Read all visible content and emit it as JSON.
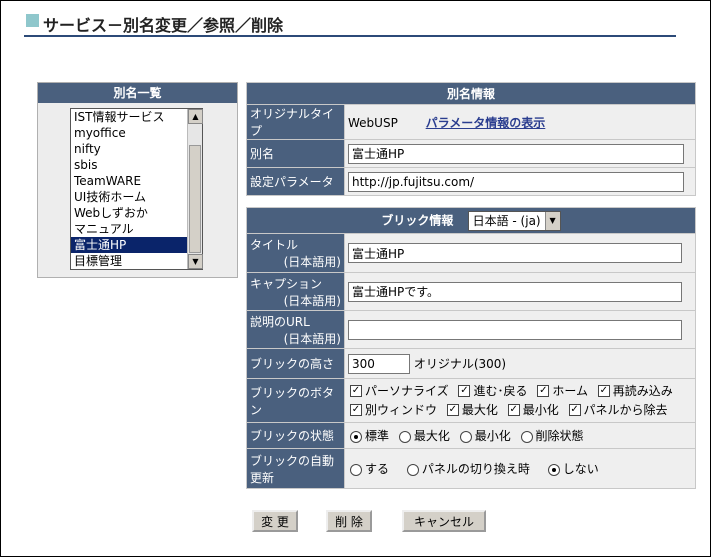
{
  "page": {
    "title": "サービス－別名変更／参照／削除"
  },
  "alias_list": {
    "header": "別名一覧",
    "items": [
      "IST情報サービス",
      "myoffice",
      "nifty",
      "sbis",
      "TeamWARE",
      "UI技術ホーム",
      "Webしずおか",
      "マニュアル",
      "富士通HP",
      "目標管理"
    ],
    "selected": "富士通HP"
  },
  "alias_info": {
    "header": "別名情報",
    "original_type_label": "オリジナルタイプ",
    "original_type_value": "WebUSP",
    "param_link": "パラメータ情報の表示",
    "alias_label": "別名",
    "alias_value": "富士通HP",
    "param_label": "設定パラメータ",
    "param_value": "http://jp.fujitsu.com/"
  },
  "brick_info": {
    "header": "ブリック情報",
    "language": "日本語 - (ja)",
    "title_label": "タイトル",
    "title_sub": "(日本語用)",
    "title_value": "富士通HP",
    "caption_label": "キャプション",
    "caption_sub": "(日本語用)",
    "caption_value": "富士通HPです。",
    "url_label": "説明のURL",
    "url_sub": "(日本語用)",
    "url_value": "",
    "height_label": "ブリックの高さ",
    "height_value": "300",
    "height_original": "オリジナル(300)",
    "buttons_label": "ブリックのボタン",
    "buttons": [
      {
        "label": "パーソナライズ",
        "checked": true
      },
      {
        "label": "進む･戻る",
        "checked": true
      },
      {
        "label": "ホーム",
        "checked": true
      },
      {
        "label": "再読み込み",
        "checked": true
      },
      {
        "label": "別ウィンドウ",
        "checked": true
      },
      {
        "label": "最大化",
        "checked": true
      },
      {
        "label": "最小化",
        "checked": true
      },
      {
        "label": "パネルから除去",
        "checked": true
      }
    ],
    "state_label": "ブリックの状態",
    "states": [
      "標準",
      "最大化",
      "最小化",
      "削除状態"
    ],
    "state_selected": "標準",
    "auto_label": "ブリックの自動更新",
    "auto_options": [
      "する",
      "パネルの切り換え時",
      "しない"
    ],
    "auto_selected": "しない"
  },
  "actions": {
    "change": "変 更",
    "delete": "削 除",
    "cancel": "キャンセル"
  },
  "colors": {
    "header_bg": "#4a607e",
    "title_rule": "#2c4a78",
    "title_square": "#8fc7cc",
    "link": "#2a3d8f"
  }
}
